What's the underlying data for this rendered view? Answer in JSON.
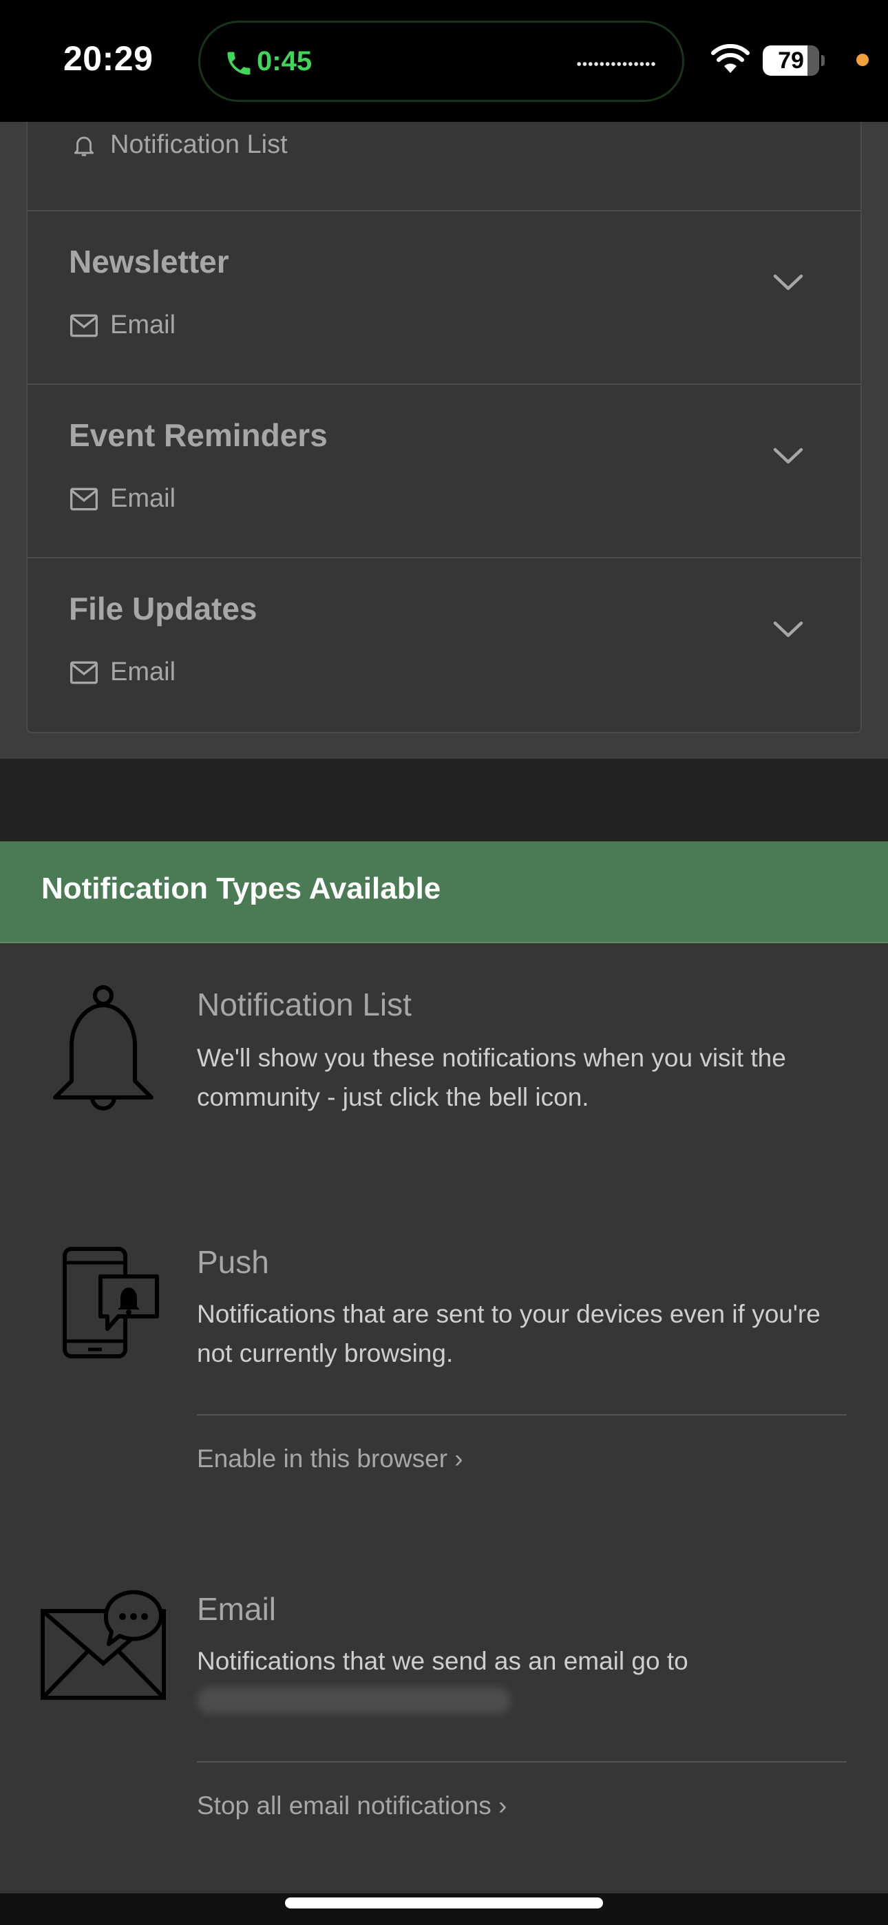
{
  "status_bar": {
    "time": "20:29",
    "call_timer": "0:45",
    "battery_level": "79",
    "battery_fraction": 0.79
  },
  "preferences": {
    "first_row_method": "Notification List",
    "rows": [
      {
        "title": "Newsletter",
        "method": "Email"
      },
      {
        "title": "Event Reminders",
        "method": "Email"
      },
      {
        "title": "File Updates",
        "method": "Email"
      }
    ]
  },
  "notification_types": {
    "heading": "Notification Types Available",
    "list": {
      "title": "Notification List",
      "description": "We'll show you these notifications when you visit the community - just click the bell icon."
    },
    "push": {
      "title": "Push",
      "description": "Notifications that are sent to your devices even if you're not currently browsing.",
      "link": "Enable in this browser"
    },
    "email": {
      "title": "Email",
      "description": "Notifications that we send as an email go to",
      "link": "Stop all email notifications"
    }
  },
  "colors": {
    "header_green": "#4a7b55",
    "call_green": "#3fd65a",
    "privacy_dot": "#f2a03c"
  }
}
